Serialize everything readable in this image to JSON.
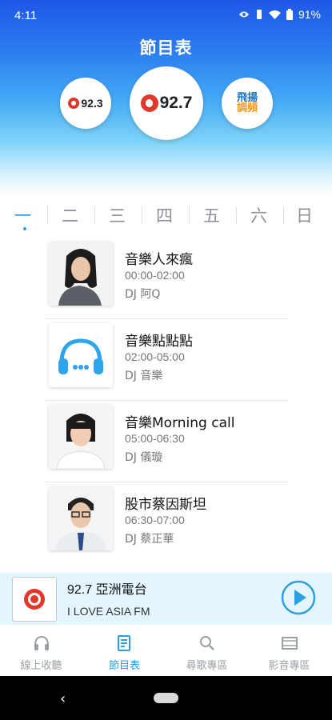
{
  "status_bar": {
    "time": "4:11",
    "battery": "91%"
  },
  "header": {
    "title": "節目表"
  },
  "stations": [
    {
      "freq": "92.3",
      "name": "FM 92.3 station logo"
    },
    {
      "freq": "92.7",
      "name": "FM 92.7 station logo"
    },
    {
      "name": "飛揚調頻",
      "line1": "飛揚",
      "line2": "調頻"
    }
  ],
  "days": [
    "一",
    "二",
    "三",
    "四",
    "五",
    "六",
    "日"
  ],
  "selected_day": "一",
  "programs": [
    {
      "title": "音樂人來瘋",
      "time": "00:00-02:00",
      "dj": "DJ 阿Q"
    },
    {
      "title": "音樂點點點",
      "time": "02:00-05:00",
      "dj": "DJ 音樂"
    },
    {
      "title": "音樂Morning call",
      "time": "05:00-06:30",
      "dj": "DJ 儀璇"
    },
    {
      "title": "股市蔡因斯坦",
      "time": "06:30-07:00",
      "dj": "DJ 蔡正華"
    }
  ],
  "player": {
    "title": "92.7 亞洲電台",
    "subtitle": "I LOVE ASIA FM"
  },
  "tabs": [
    {
      "label": "線上收聽",
      "icon": "headphones-icon"
    },
    {
      "label": "節目表",
      "icon": "schedule-icon"
    },
    {
      "label": "尋歌專區",
      "icon": "search-icon"
    },
    {
      "label": "影音專區",
      "icon": "video-icon"
    }
  ],
  "colors": {
    "accent": "#2aa0e0",
    "brand_red": "#e0382b",
    "header_top": "#1e57e6"
  }
}
